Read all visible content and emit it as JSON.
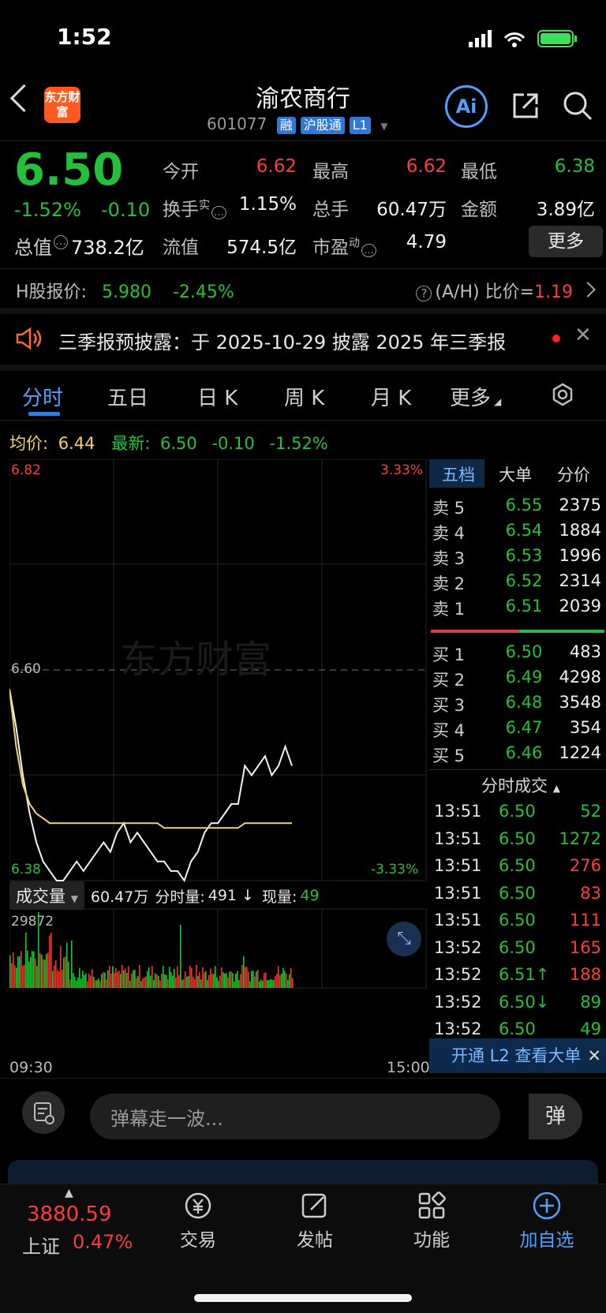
{
  "status": {
    "time": "1:52"
  },
  "header": {
    "title": "渝农商行",
    "code": "601077",
    "tags": [
      "融",
      "沪股通",
      "L1"
    ],
    "logo_text": "东方财富",
    "ai_label": "Ai"
  },
  "quote": {
    "price": "6.50",
    "change_pct": "-1.52%",
    "change_abs": "-0.10",
    "open_label": "今开",
    "open": "6.62",
    "high_label": "最高",
    "high": "6.62",
    "low_label": "最低",
    "low": "6.38",
    "turnover_label": "换手",
    "turnover_sup": "实",
    "turnover": "1.15%",
    "volume_label": "总手",
    "volume": "60.47万",
    "amount_label": "金额",
    "amount": "3.89亿",
    "mktcap_label": "总值",
    "mktcap": "738.2亿",
    "float_label": "流值",
    "float": "574.5亿",
    "pe_label": "市盈",
    "pe_sup": "动",
    "pe": "4.79",
    "more_label": "更多"
  },
  "hshare": {
    "label": "H股报价:",
    "price": "5.980",
    "pct": "-2.45%",
    "ratio_label": "(A/H) 比价=",
    "ratio": "1.19"
  },
  "notice": {
    "text": "三季报预披露：于 2025-10-29 披露 2025 年三季报"
  },
  "tabs": [
    "分时",
    "五日",
    "日 K",
    "周 K",
    "月 K",
    "更多"
  ],
  "avgline": {
    "avg_label": "均价:",
    "avg": "6.44",
    "latest_label": "最新:",
    "latest": "6.50",
    "chg": "-0.10",
    "pct": "-1.52%"
  },
  "chart": {
    "y_top": "6.82",
    "y_mid": "6.60",
    "y_bot": "6.38",
    "pct_top": "3.33%",
    "pct_bot": "-3.33%",
    "watermark": "东方财富",
    "vol_label": "成交量",
    "vol_total": "60.47万",
    "vol_minute_label": "分时量:",
    "vol_minute": "491 ↓",
    "vol_now_label": "现量:",
    "vol_now": "49",
    "vol_max": "29872",
    "x_start": "09:30",
    "x_end": "15:00"
  },
  "chart_data": {
    "type": "line",
    "title": "",
    "ylim": [
      6.38,
      6.82
    ],
    "prev_close": 6.6,
    "series": [
      {
        "values": [
          6.58,
          6.54,
          6.49,
          6.45,
          6.42,
          6.4,
          6.39,
          6.38,
          6.38,
          6.39,
          6.4,
          6.39,
          6.4,
          6.41,
          6.42,
          6.41,
          6.43,
          6.44,
          6.42,
          6.43,
          6.42,
          6.41,
          6.4,
          6.4,
          6.39,
          6.39,
          6.38,
          6.4,
          6.41,
          6.43,
          6.44,
          6.44,
          6.45,
          6.46,
          6.46,
          6.5,
          6.49,
          6.5,
          6.51,
          6.49,
          6.5,
          6.52,
          6.5
        ]
      },
      {
        "values": [
          6.58,
          6.52,
          6.48,
          6.46,
          6.45,
          6.445,
          6.44,
          6.44,
          6.44,
          6.44,
          6.44,
          6.44,
          6.44,
          6.44,
          6.44,
          6.44,
          6.44,
          6.44,
          6.44,
          6.44,
          6.44,
          6.44,
          6.44,
          6.435,
          6.435,
          6.435,
          6.435,
          6.435,
          6.435,
          6.435,
          6.435,
          6.435,
          6.435,
          6.435,
          6.435,
          6.44,
          6.44,
          6.44,
          6.44,
          6.44,
          6.44,
          6.44,
          6.44
        ]
      }
    ]
  },
  "orderbook": {
    "tabs": [
      "五档",
      "大单",
      "分价"
    ],
    "asks": [
      {
        "label": "卖 5",
        "price": "6.55",
        "vol": "2375"
      },
      {
        "label": "卖 4",
        "price": "6.54",
        "vol": "1884"
      },
      {
        "label": "卖 3",
        "price": "6.53",
        "vol": "1996"
      },
      {
        "label": "卖 2",
        "price": "6.52",
        "vol": "2314"
      },
      {
        "label": "卖 1",
        "price": "6.51",
        "vol": "2039"
      }
    ],
    "bids": [
      {
        "label": "买 1",
        "price": "6.50",
        "vol": "483"
      },
      {
        "label": "买 2",
        "price": "6.49",
        "vol": "4298"
      },
      {
        "label": "买 3",
        "price": "6.48",
        "vol": "3548"
      },
      {
        "label": "买 4",
        "price": "6.47",
        "vol": "354"
      },
      {
        "label": "买 5",
        "price": "6.46",
        "vol": "1224"
      }
    ],
    "trades_title": "分时成交",
    "trades": [
      {
        "time": "13:51",
        "price": "6.50",
        "vol": "52",
        "dir": "down"
      },
      {
        "time": "13:51",
        "price": "6.50",
        "vol": "1272",
        "dir": "down"
      },
      {
        "time": "13:51",
        "price": "6.50",
        "vol": "276",
        "dir": "up"
      },
      {
        "time": "13:51",
        "price": "6.50",
        "vol": "83",
        "dir": "up"
      },
      {
        "time": "13:51",
        "price": "6.50",
        "vol": "111",
        "dir": "up"
      },
      {
        "time": "13:52",
        "price": "6.50",
        "vol": "165",
        "dir": "up"
      },
      {
        "time": "13:52",
        "price": "6.51↑",
        "vol": "188",
        "dir": "up"
      },
      {
        "time": "13:52",
        "price": "6.50↓",
        "vol": "89",
        "dir": "down"
      },
      {
        "time": "13:52",
        "price": "6.50",
        "vol": "49",
        "dir": "down"
      }
    ],
    "l2_label": "开通 L2 查看大单"
  },
  "danmu": {
    "placeholder": "弹幕走一波...",
    "send_label": "弹"
  },
  "bottombar": {
    "index_value": "3880.59",
    "index_name": "上证",
    "index_pct": "0.47%",
    "items": [
      "交易",
      "发帖",
      "功能",
      "加自选"
    ]
  },
  "colors": {
    "up": "#ff3b3b",
    "down": "#23c13a",
    "accent": "#4ea1ff"
  }
}
